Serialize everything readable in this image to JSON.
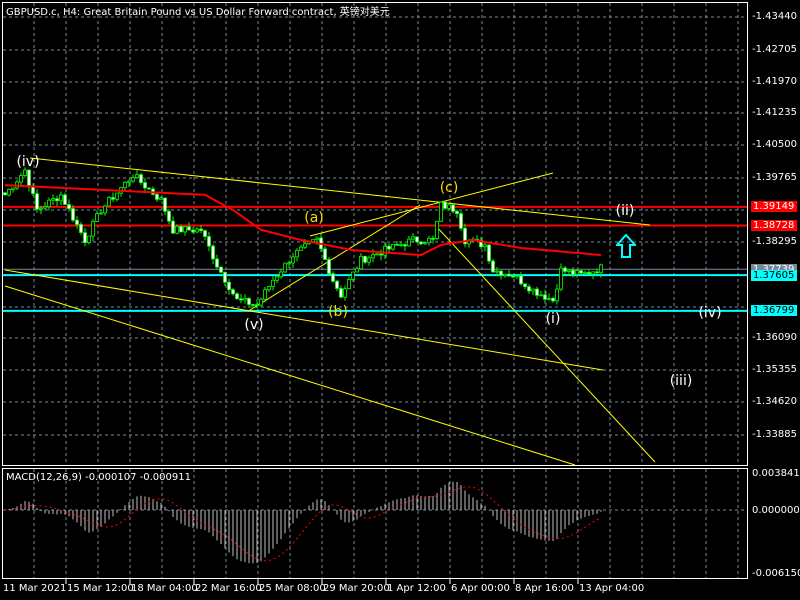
{
  "header": {
    "title": "GBPUSD.c, H4:  Great Britain Pound vs US Dollar Forward contract, 英镑对美元"
  },
  "price_axis": {
    "labels": [
      "1.43440",
      "1.42705",
      "1.41970",
      "1.41235",
      "1.40500",
      "1.39765",
      "1.38295",
      "1.36090",
      "1.35355",
      "1.34620",
      "1.33885"
    ]
  },
  "price_tags": [
    {
      "value": "1.39149",
      "bg": "#ff0000",
      "fg": "#ffffff"
    },
    {
      "value": "1.38728",
      "bg": "#ff0000",
      "fg": "#ffffff"
    },
    {
      "value": "1.37739",
      "bg": "#778899",
      "fg": "#ffffff"
    },
    {
      "value": "1.37605",
      "bg": "#00ffff",
      "fg": "#000000"
    },
    {
      "value": "1.36799",
      "bg": "#00ffff",
      "fg": "#000000"
    }
  ],
  "time_axis": {
    "labels": [
      "11 Mar 2021",
      "15 Mar 12:00",
      "18 Mar 04:00",
      "22 Mar 16:00",
      "25 Mar 08:00",
      "29 Mar 20:00",
      "1 Apr 12:00",
      "6 Apr 00:00",
      "8 Apr 16:00",
      "13 Apr 04:00"
    ]
  },
  "macd": {
    "title": "MACD(12,26,9) -0.000107 -0.000911",
    "axis": [
      "0.003841",
      "0.000000",
      "-0.006150"
    ]
  },
  "wave_labels": [
    {
      "text": "(iv)",
      "color": "#ffffff"
    },
    {
      "text": "(a)",
      "color": "#ffd700"
    },
    {
      "text": "(c)",
      "color": "#ffd700"
    },
    {
      "text": "(ii)",
      "color": "#ffffff"
    },
    {
      "text": "(b)",
      "color": "#ffd700"
    },
    {
      "text": "(v)",
      "color": "#ffffff"
    },
    {
      "text": "(i)",
      "color": "#ffffff"
    },
    {
      "text": "(iv)",
      "color": "#ffffff"
    },
    {
      "text": "(iii)",
      "color": "#ffffff"
    }
  ],
  "colors": {
    "candle": "#00ff00",
    "ma": "#ff0000",
    "trend": "#ffff00",
    "grid": "#778899",
    "signal": "#ff0000",
    "histogram": "#c0c0c0"
  },
  "chart_data": {
    "type": "candlestick",
    "symbol": "GBPUSD.c",
    "timeframe": "H4",
    "price_range": [
      1.3315,
      1.438
    ],
    "price_path": [
      [
        0,
        1.3942
      ],
      [
        5,
        1.3998
      ],
      [
        8,
        1.3908
      ],
      [
        14,
        1.3942
      ],
      [
        20,
        1.384
      ],
      [
        24,
        1.3908
      ],
      [
        32,
        1.3987
      ],
      [
        39,
        1.393
      ],
      [
        42,
        1.3863
      ],
      [
        49,
        1.3863
      ],
      [
        53,
        1.3784
      ],
      [
        58,
        1.3704
      ],
      [
        63,
        1.3693
      ],
      [
        67,
        1.375
      ],
      [
        72,
        1.3806
      ],
      [
        78,
        1.384
      ],
      [
        82,
        1.375
      ],
      [
        84,
        1.3716
      ],
      [
        89,
        1.3795
      ],
      [
        95,
        1.3817
      ],
      [
        102,
        1.384
      ],
      [
        107,
        1.384
      ],
      [
        109,
        1.3919
      ],
      [
        113,
        1.3908
      ],
      [
        115,
        1.384
      ],
      [
        120,
        1.3829
      ],
      [
        122,
        1.3772
      ],
      [
        127,
        1.3761
      ],
      [
        132,
        1.3727
      ],
      [
        137,
        1.3704
      ],
      [
        139,
        1.3772
      ],
      [
        144,
        1.3761
      ],
      [
        149,
        1.3777
      ]
    ],
    "ma_path": [
      [
        0,
        1.3964
      ],
      [
        50,
        1.3942
      ],
      [
        57,
        1.3908
      ],
      [
        64,
        1.3863
      ],
      [
        74,
        1.384
      ],
      [
        87,
        1.3817
      ],
      [
        104,
        1.3806
      ],
      [
        109,
        1.3829
      ],
      [
        117,
        1.384
      ],
      [
        129,
        1.3822
      ],
      [
        149,
        1.3806
      ]
    ],
    "horizontal_levels": [
      1.39149,
      1.38728,
      1.37739,
      1.37605,
      1.36799
    ],
    "macd": {
      "fast": 12,
      "slow": 26,
      "signal": 9,
      "main": -0.000107,
      "signal_value": -0.000911,
      "range": [
        -0.00615,
        0.003841
      ]
    }
  }
}
